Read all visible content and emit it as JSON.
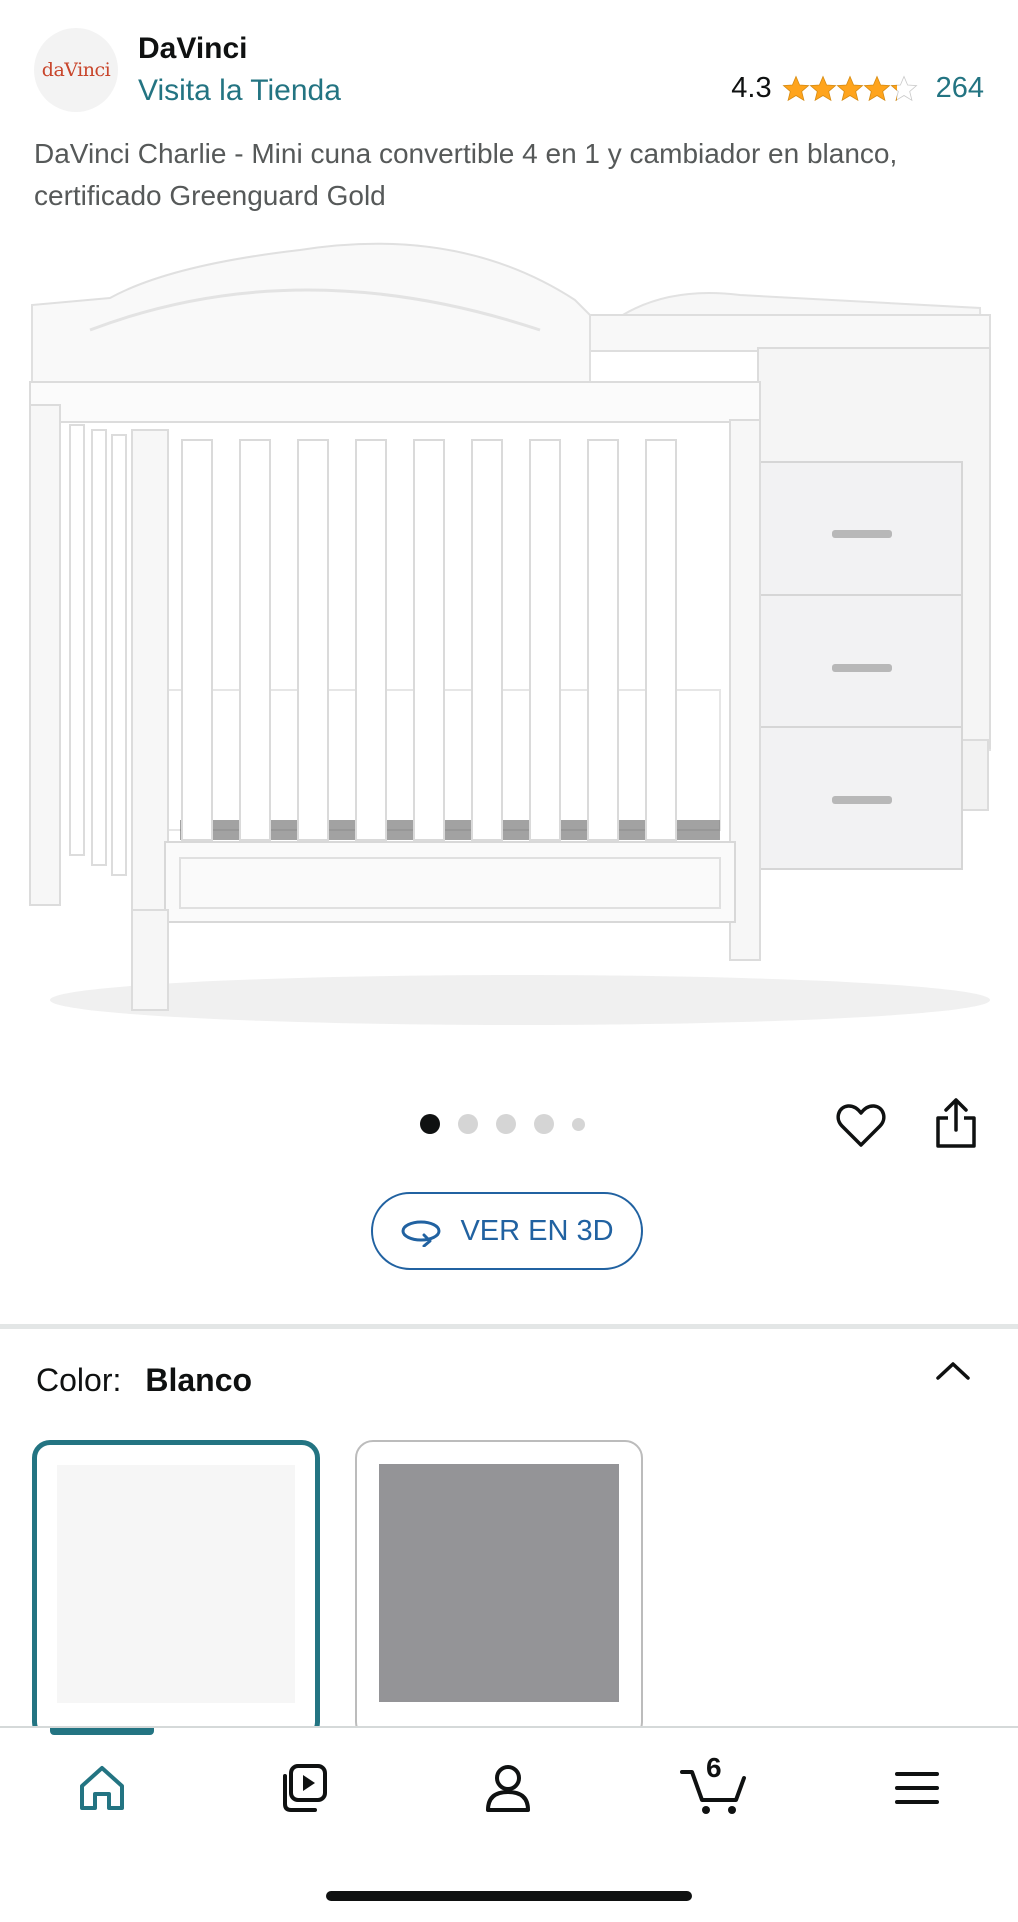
{
  "header": {
    "logo_text": "daVinci",
    "brand_name": "DaVinci",
    "store_link": "Visita la Tienda",
    "rating": "4.3",
    "review_count": "264",
    "rating_value": 4.3,
    "rating_max": 5
  },
  "product": {
    "title": "DaVinci Charlie - Mini cuna convertible 4 en 1 y cambiador en blanco, certificado Greenguard Gold",
    "image_icon": "crib-with-changer-image"
  },
  "carousel": {
    "total_dots": 5,
    "active_index": 0
  },
  "view3d": {
    "label": "VER EN 3D",
    "icon": "rotate-3d-icon"
  },
  "color_selector": {
    "label": "Color:",
    "selected": "Blanco",
    "options": [
      {
        "name": "white",
        "color": "#f6f6f6"
      },
      {
        "name": "gray",
        "color": "#949497"
      }
    ]
  },
  "bottom_nav": {
    "items": [
      "home-icon",
      "video-icon",
      "account-icon",
      "cart-icon",
      "menu-icon"
    ],
    "cart_count": "6",
    "active": "home"
  },
  "colors": {
    "link": "#237482",
    "button_blue": "#2162a1",
    "star": "#ffa41c",
    "text": "#0f1111",
    "muted": "#565959"
  }
}
